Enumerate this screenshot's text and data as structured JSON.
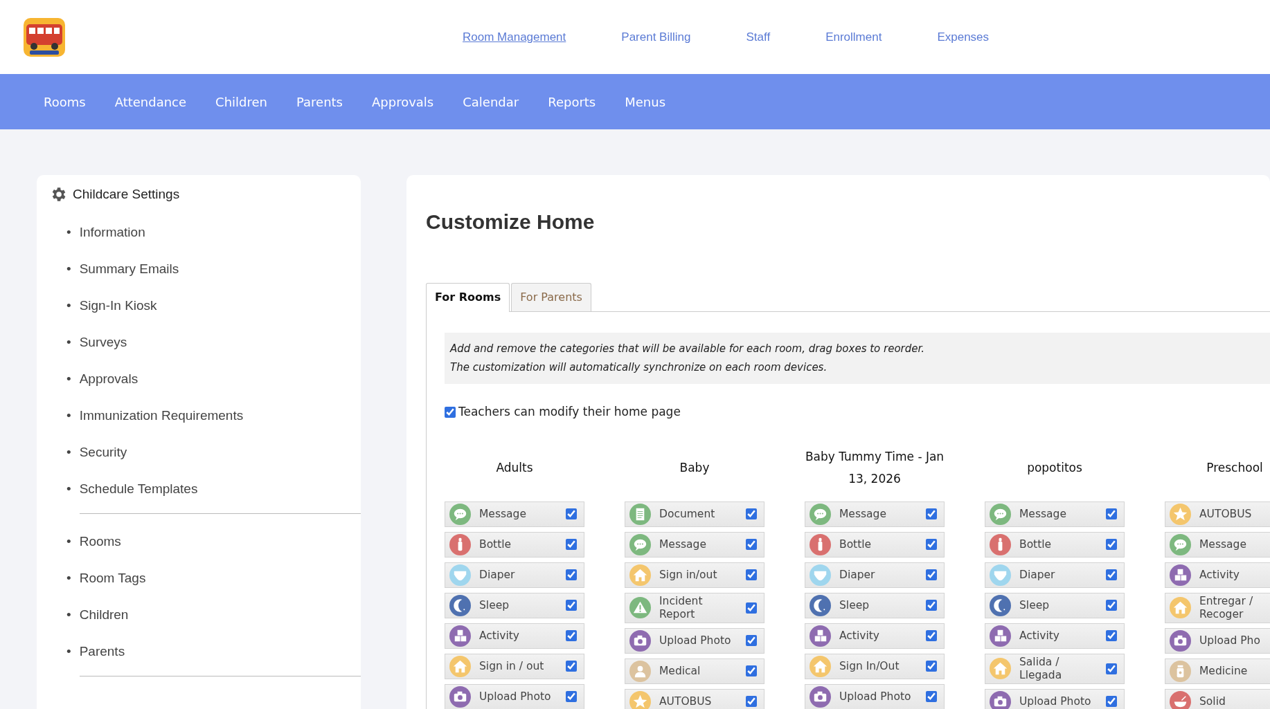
{
  "top_links": [
    {
      "label": "Room Management",
      "selected": true
    },
    {
      "label": "Parent Billing",
      "selected": false
    },
    {
      "label": "Staff",
      "selected": false
    },
    {
      "label": "Enrollment",
      "selected": false
    },
    {
      "label": "Expenses",
      "selected": false
    }
  ],
  "nav": [
    "Rooms",
    "Attendance",
    "Children",
    "Parents",
    "Approvals",
    "Calendar",
    "Reports",
    "Menus"
  ],
  "sidebar": {
    "title": "Childcare Settings",
    "bullet": "•",
    "groups": [
      [
        "Information",
        "Summary Emails",
        "Sign-In Kiosk",
        "Surveys",
        "Approvals",
        "Immunization Requirements",
        "Security",
        "Schedule Templates"
      ],
      [
        "Rooms",
        "Room Tags",
        "Children",
        "Parents"
      ]
    ]
  },
  "page_title": "Customize Home",
  "tabs": [
    {
      "label": "For Rooms",
      "selected": true
    },
    {
      "label": "For Parents",
      "selected": false
    }
  ],
  "info_lines": [
    "Add and remove the categories that will be available for each room, drag boxes to reorder.",
    "The customization will automatically synchronize on each room devices."
  ],
  "teachers_modify": {
    "label": "Teachers can modify their home page",
    "checked": true
  },
  "rooms": [
    {
      "name": "Adults",
      "items": [
        {
          "kind": "message",
          "label": "Message",
          "checked": true
        },
        {
          "kind": "bottle",
          "label": "Bottle",
          "checked": true
        },
        {
          "kind": "diaper",
          "label": "Diaper",
          "checked": true
        },
        {
          "kind": "sleep",
          "label": "Sleep",
          "checked": true
        },
        {
          "kind": "activity",
          "label": "Activity",
          "checked": true
        },
        {
          "kind": "home",
          "label": "Sign in / out",
          "checked": true
        },
        {
          "kind": "camera",
          "label": "Upload Photo",
          "checked": true
        }
      ]
    },
    {
      "name": "Baby",
      "items": [
        {
          "kind": "document",
          "label": "Document",
          "checked": true
        },
        {
          "kind": "message",
          "label": "Message",
          "checked": true
        },
        {
          "kind": "home",
          "label": "Sign in/out",
          "checked": true
        },
        {
          "kind": "incident",
          "label": "Incident Report",
          "checked": true
        },
        {
          "kind": "camera",
          "label": "Upload Photo",
          "checked": true
        },
        {
          "kind": "medical",
          "label": "Medical",
          "checked": true
        },
        {
          "kind": "star",
          "label": "AUTOBUS",
          "checked": true
        }
      ]
    },
    {
      "name": "Baby Tummy Time - Jan 13, 2026",
      "items": [
        {
          "kind": "message",
          "label": "Message",
          "checked": true
        },
        {
          "kind": "bottle",
          "label": "Bottle",
          "checked": true
        },
        {
          "kind": "diaper",
          "label": "Diaper",
          "checked": true
        },
        {
          "kind": "sleep",
          "label": "Sleep",
          "checked": true
        },
        {
          "kind": "activity",
          "label": "Activity",
          "checked": true
        },
        {
          "kind": "home",
          "label": "Sign In/Out",
          "checked": true
        },
        {
          "kind": "camera",
          "label": "Upload Photo",
          "checked": true
        }
      ]
    },
    {
      "name": "popotitos",
      "items": [
        {
          "kind": "message",
          "label": "Message",
          "checked": true
        },
        {
          "kind": "bottle",
          "label": "Bottle",
          "checked": true
        },
        {
          "kind": "diaper",
          "label": "Diaper",
          "checked": true
        },
        {
          "kind": "sleep",
          "label": "Sleep",
          "checked": true
        },
        {
          "kind": "activity",
          "label": "Activity",
          "checked": true
        },
        {
          "kind": "home",
          "label": "Salida / Llegada",
          "checked": true
        },
        {
          "kind": "camera",
          "label": "Upload Photo",
          "checked": true
        }
      ]
    },
    {
      "name": "Preschool",
      "items": [
        {
          "kind": "star",
          "label": "AUTOBUS"
        },
        {
          "kind": "message",
          "label": "Message"
        },
        {
          "kind": "activity",
          "label": "Activity"
        },
        {
          "kind": "home",
          "label": "Entregar / Recoger"
        },
        {
          "kind": "camera",
          "label": "Upload Pho"
        },
        {
          "kind": "medicine",
          "label": "Medicine"
        },
        {
          "kind": "solid",
          "label": "Solid"
        }
      ]
    }
  ]
}
